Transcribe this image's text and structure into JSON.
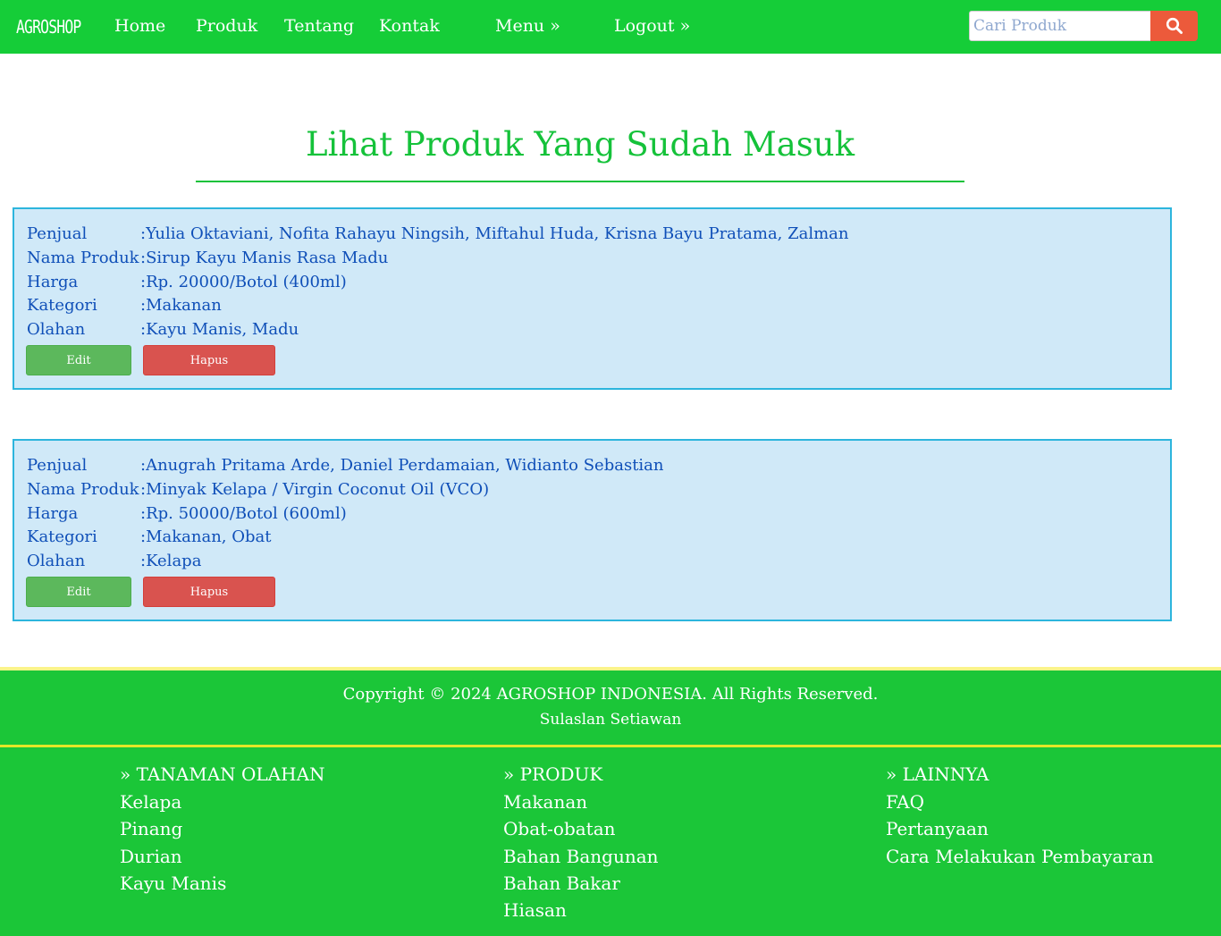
{
  "navbar": {
    "brand": "AGROSHOP",
    "links": [
      "Home",
      "Produk",
      "Tentang",
      "Kontak",
      "Menu »",
      "Logout »"
    ],
    "search_placeholder": "Cari Produk",
    "search_icon": "search-icon",
    "color": "#15cd38",
    "search_button_color": "#ec5a3b"
  },
  "page": {
    "title": "Lihat Produk Yang Sudah Masuk"
  },
  "products": [
    {
      "labels": [
        "Penjual",
        "Nama Produk",
        "Harga",
        "Kategori",
        "Olahan"
      ],
      "values": [
        ":Yulia Oktaviani, Nofita Rahayu Ningsih, Miftahul Huda, Krisna Bayu Pratama, Zalman",
        ":Sirup Kayu Manis Rasa Madu",
        ":Rp. 20000/Botol (400ml)",
        ":Makanan",
        ":Kayu Manis, Madu"
      ],
      "edit_label": "Edit",
      "delete_label": "Hapus"
    },
    {
      "labels": [
        "Penjual",
        "Nama Produk",
        "Harga",
        "Kategori",
        "Olahan"
      ],
      "values": [
        ":Anugrah Pritama Arde, Daniel Perdamaian, Widianto Sebastian",
        ":Minyak Kelapa / Virgin Coconut Oil (VCO)",
        ":Rp. 50000/Botol (600ml)",
        ":Makanan, Obat",
        ":Kelapa"
      ],
      "edit_label": "Edit",
      "delete_label": "Hapus"
    }
  ],
  "footer": {
    "copyright": "Copyright © 2024 AGROSHOP INDONESIA. All Rights Reserved.",
    "author": "Sulaslan Setiawan",
    "columns": [
      {
        "title": "» TANAMAN OLAHAN",
        "items": [
          "Kelapa",
          "Pinang",
          "Durian",
          "Kayu Manis"
        ]
      },
      {
        "title": "» PRODUK",
        "items": [
          "Makanan",
          "Obat-obatan",
          "Bahan Bangunan",
          "Bahan Bakar",
          "Hiasan"
        ]
      },
      {
        "title": "» LAINNYA",
        "items": [
          "FAQ",
          "Pertanyaan",
          "Cara Melakukan Pembayaran"
        ]
      }
    ],
    "color": "#1bc638"
  }
}
